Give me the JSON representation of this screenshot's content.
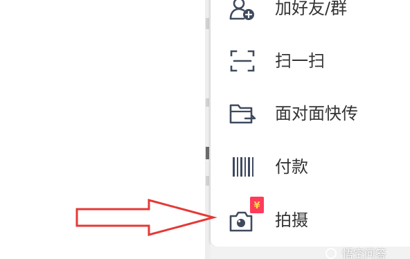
{
  "menu": {
    "items": [
      {
        "label": "加好友/群",
        "icon": "add-friend-icon"
      },
      {
        "label": "扫一扫",
        "icon": "scan-icon"
      },
      {
        "label": "面对面快传",
        "icon": "folder-transfer-icon"
      },
      {
        "label": "付款",
        "icon": "barcode-icon"
      },
      {
        "label": "拍摄",
        "icon": "camera-icon",
        "badge": "¥"
      }
    ]
  },
  "annotation": {
    "icon": "red-arrow-icon"
  },
  "watermark": {
    "text": "悟空问答"
  },
  "colors": {
    "icon": "#3f4a5e",
    "text": "#333333",
    "badge": "#ff3b5c",
    "arrow": "#e53935"
  }
}
